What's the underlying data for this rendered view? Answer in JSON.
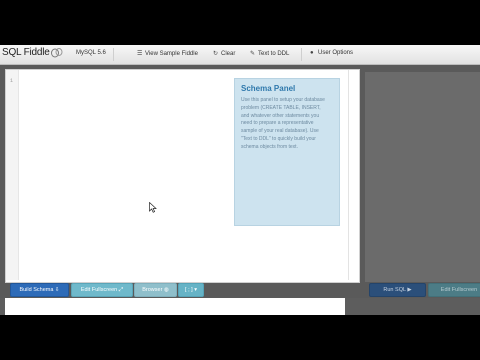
{
  "navbar": {
    "brand": "SQL Fiddle",
    "db_version": "MySQL 5.6",
    "items": [
      {
        "label": "View Sample Fiddle",
        "icon": "list-icon"
      },
      {
        "label": "Clear",
        "icon": "refresh-icon"
      },
      {
        "label": "Text to DDL",
        "icon": "wrench-icon"
      },
      {
        "label": "User Options",
        "icon": "user-icon"
      }
    ]
  },
  "editor": {
    "line_number": "1"
  },
  "schema_panel": {
    "title": "Schema Panel",
    "text": "Use this panel to setup your database problem (CREATE TABLE, INSERT, and whatever other statements you need to prepare a representative sample of your real database). Use \"Text to DDL\" to quickly build your schema objects from text."
  },
  "buttons": {
    "build_schema": "Build Schema",
    "edit_fullscreen": "Edit Fullscreen",
    "browser": "Browser",
    "delimiter": "[ ; ]",
    "run_sql": "Run SQL",
    "edit_fullscreen_right": "Edit Fullscreen"
  },
  "colors": {
    "accent": "#2d6bb8",
    "schema_title": "#2f79ac",
    "schema_bg": "#cde3ef"
  }
}
